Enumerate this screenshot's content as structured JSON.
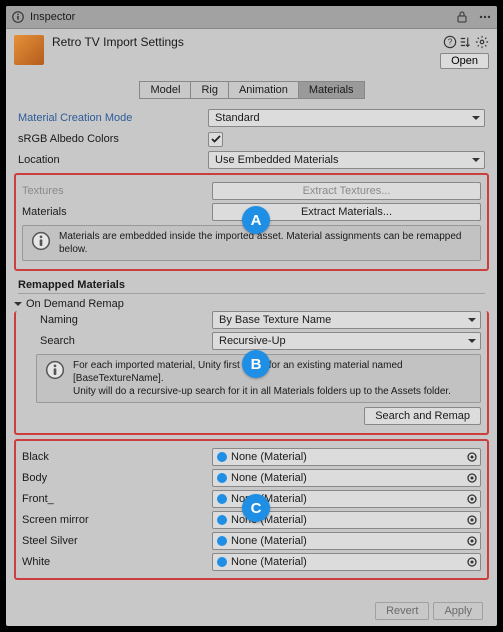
{
  "window": {
    "title": "Inspector"
  },
  "header": {
    "title": "Retro TV Import Settings",
    "open": "Open"
  },
  "tabs": [
    "Model",
    "Rig",
    "Animation",
    "Materials"
  ],
  "active_tab": 3,
  "fields": {
    "mcm_label": "Material Creation Mode",
    "mcm_value": "Standard",
    "srgb_label": "sRGB Albedo Colors",
    "srgb_checked": true,
    "loc_label": "Location",
    "loc_value": "Use Embedded Materials",
    "tex_label": "Textures",
    "tex_btn": "Extract Textures...",
    "mat_label": "Materials",
    "mat_btn": "Extract Materials..."
  },
  "info1": "Materials are embedded inside the imported asset. Material assignments can be remapped below.",
  "remapped_header": "Remapped Materials",
  "odremap": "On Demand Remap",
  "naming": {
    "label": "Naming",
    "value": "By Base Texture Name"
  },
  "search": {
    "label": "Search",
    "value": "Recursive-Up"
  },
  "info2": "For each imported material, Unity first looks for an existing material named [BaseTextureName].\nUnity will do a recursive-up search for it in all Materials folders up to the Assets folder.",
  "search_remap": "Search and Remap",
  "slots": [
    {
      "name": "Black",
      "value": "None (Material)"
    },
    {
      "name": "Body",
      "value": "None (Material)"
    },
    {
      "name": "Front_",
      "value": "None (Material)"
    },
    {
      "name": "Screen mirror",
      "value": "None (Material)"
    },
    {
      "name": "Steel Silver",
      "value": "None (Material)"
    },
    {
      "name": "White",
      "value": "None (Material)"
    }
  ],
  "callouts": {
    "a": "A",
    "b": "B",
    "c": "C"
  },
  "footer": {
    "revert": "Revert",
    "apply": "Apply"
  }
}
